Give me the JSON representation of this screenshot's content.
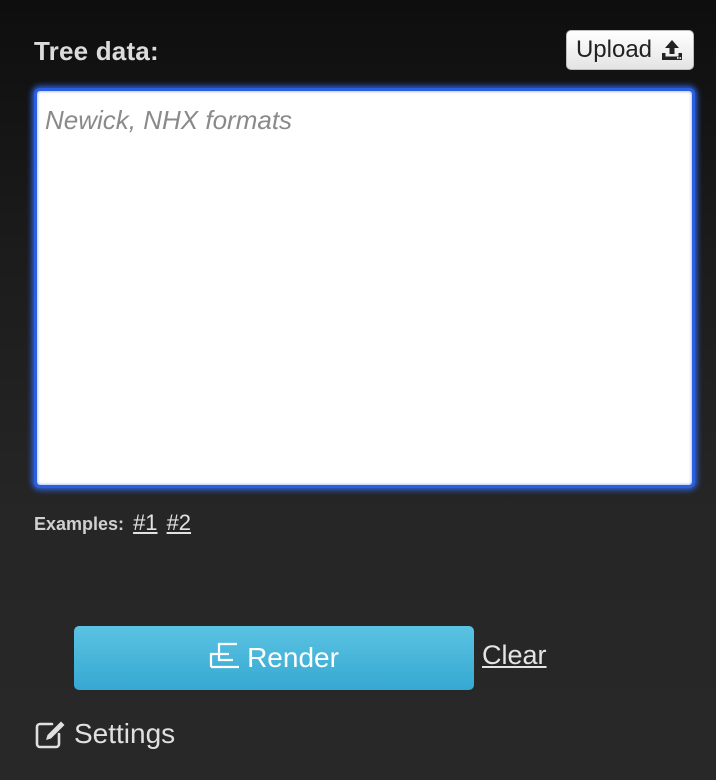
{
  "tree_panel": {
    "title": "Tree data:",
    "upload": {
      "label": "Upload",
      "icon": "upload-icon"
    },
    "textarea": {
      "value": "",
      "placeholder": "Newick, NHX formats"
    },
    "examples": {
      "label": "Examples:",
      "links": [
        "#1",
        "#2"
      ]
    },
    "render": {
      "label": "Render",
      "icon": "tree-icon"
    },
    "clear": {
      "label": "Clear"
    },
    "settings": {
      "label": "Settings",
      "icon": "edit-icon"
    }
  },
  "colors": {
    "focus_border": "#2a5fe0",
    "render_button": "#44b3d9",
    "background_top": "#0e0e0e",
    "background_bottom": "#282828"
  }
}
